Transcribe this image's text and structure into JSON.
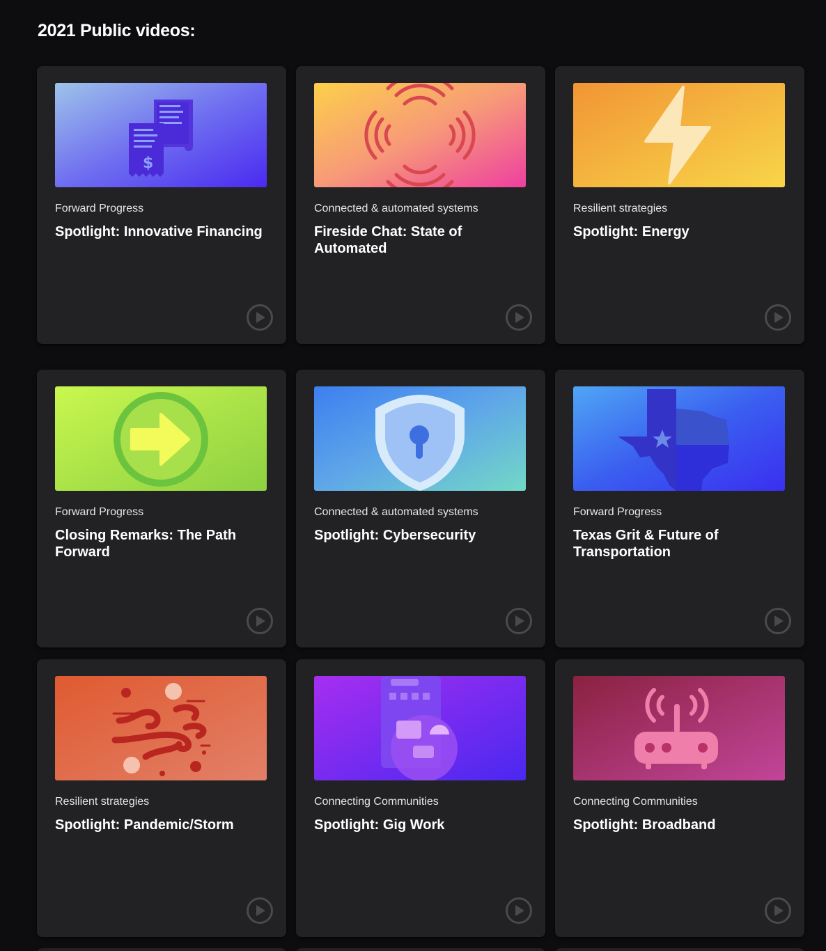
{
  "page": {
    "title": "2021 Public videos:"
  },
  "videos": [
    {
      "category": "Forward Progress",
      "title": "Spotlight: Innovative Financing",
      "icon": "receipts-icon"
    },
    {
      "category": "Connected & automated systems",
      "title": "Fireside Chat: State of Automated",
      "icon": "signal-icon"
    },
    {
      "category": "Resilient strategies",
      "title": "Spotlight: Energy",
      "icon": "lightning-icon"
    },
    {
      "category": "Forward Progress",
      "title": "Closing Remarks: The Path Forward",
      "icon": "arrow-circle-icon"
    },
    {
      "category": "Connected & automated systems",
      "title": "Spotlight: Cybersecurity",
      "icon": "shield-lock-icon"
    },
    {
      "category": "Forward Progress",
      "title": "Texas Grit & Future of Transportation",
      "icon": "texas-map-icon"
    },
    {
      "category": "Resilient strategies",
      "title": "Spotlight: Pandemic/Storm",
      "icon": "wind-virus-icon"
    },
    {
      "category": "Connecting Communities",
      "title": "Spotlight: Gig Work",
      "icon": "phone-delivery-icon"
    },
    {
      "category": "Connecting Communities",
      "title": "Spotlight: Broadband",
      "icon": "router-icon"
    }
  ]
}
